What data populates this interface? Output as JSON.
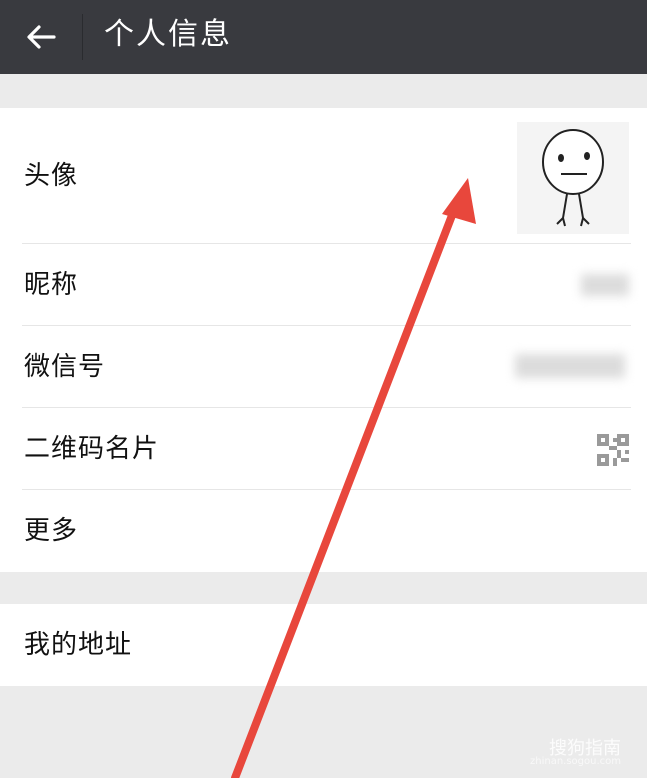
{
  "header": {
    "back_icon": "arrow-left-icon",
    "title": "个人信息"
  },
  "profile": {
    "avatar_label": "头像",
    "nickname_label": "昵称",
    "wechat_id_label": "微信号",
    "qr_card_label": "二维码名片",
    "qr_icon": "qr-code-icon",
    "more_label": "更多"
  },
  "address": {
    "label": "我的地址"
  },
  "watermark": {
    "text": "搜狗指南",
    "sub": "zhinan.sogou.com"
  },
  "colors": {
    "header_bg": "#393a3f",
    "page_bg": "#ebebeb",
    "annotation_arrow": "#e8473c"
  }
}
